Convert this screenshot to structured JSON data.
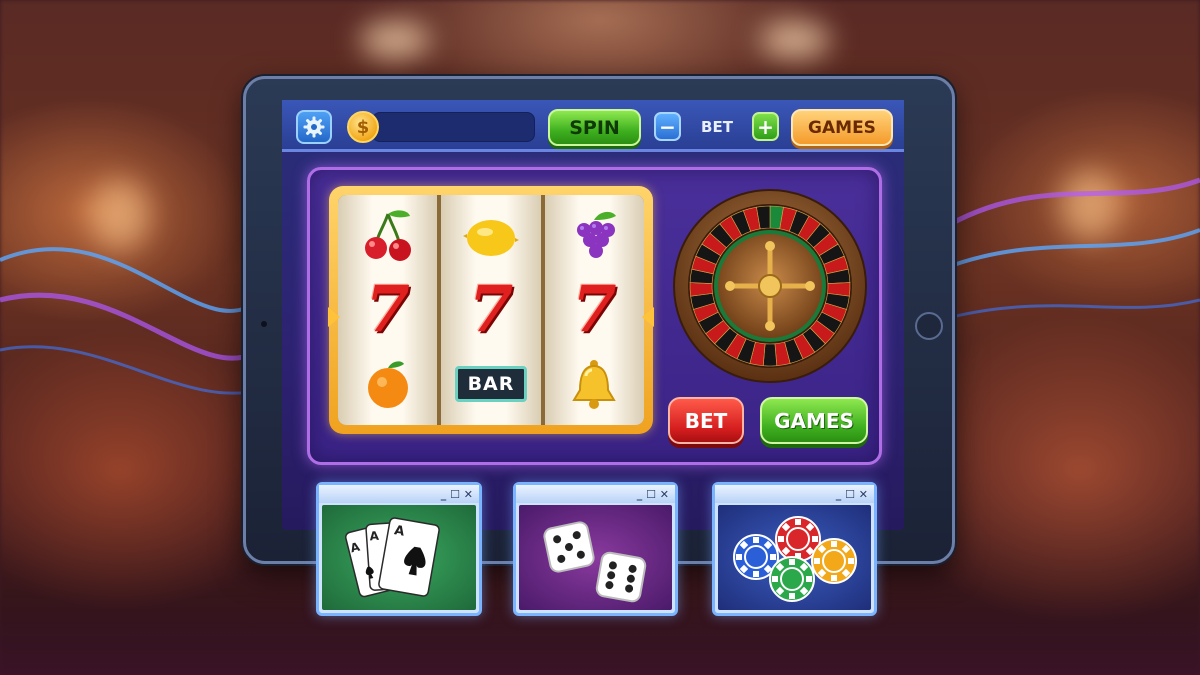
{
  "topbar": {
    "coin_symbol": "$",
    "spin_label": "SPIN",
    "bet_minus": "−",
    "bet_label": "BET",
    "bet_plus": "+",
    "games_label": "GAMES"
  },
  "slot": {
    "reels": [
      [
        "cherry",
        "seven",
        "orange"
      ],
      [
        "lemon",
        "seven",
        "bar"
      ],
      [
        "grapes",
        "seven",
        "bell"
      ]
    ],
    "seven_text": "7",
    "bar_text": "BAR"
  },
  "actions": {
    "bet_label": "BET",
    "games_label": "GAMES"
  },
  "mini_windows": [
    {
      "name": "cards",
      "controls": "_ ☐ ✕"
    },
    {
      "name": "dice",
      "controls": "_ ☐ ✕"
    },
    {
      "name": "chips",
      "controls": "_ ☐ ✕"
    }
  ],
  "card_labels": {
    "rank": "A"
  },
  "colors": {
    "spin_green": "#3fb020",
    "games_orange": "#f59b2b",
    "bet_red": "#d41e1e",
    "panel_purple": "#b06ee6"
  }
}
